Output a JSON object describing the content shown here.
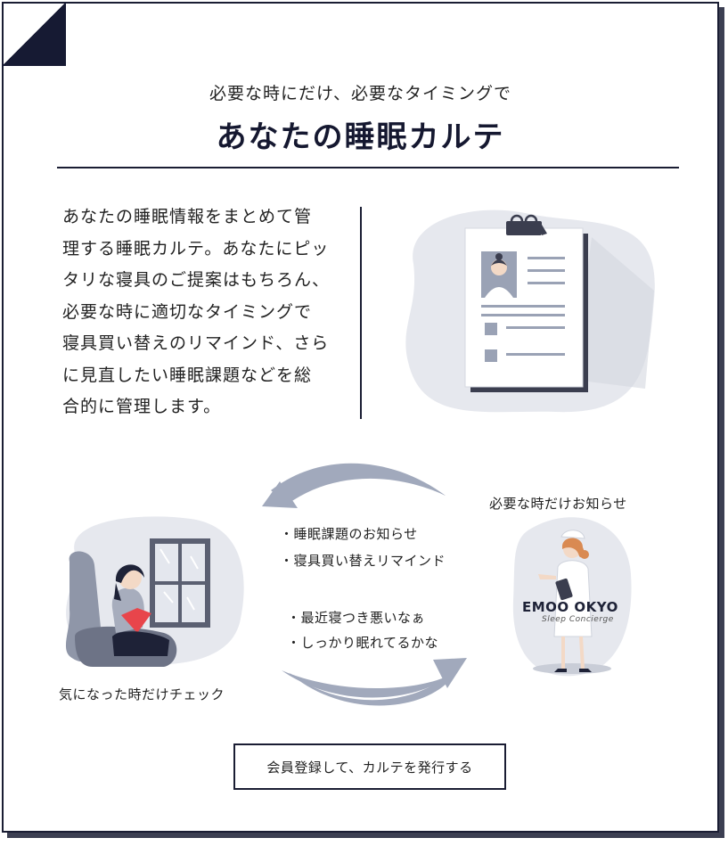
{
  "header": {
    "subtitle": "必要な時にだけ、必要なタイミングで",
    "title": "あなたの睡眠カルテ"
  },
  "description": {
    "lines": [
      "あなたの睡眠情報をまとめて管",
      "理する睡眠カルテ。あなたにピッ",
      "タリな寝具のご提案はもちろん、",
      "必要な時に適切なタイミングで",
      "寝具買い替えのリマインド、さら",
      "に見直したい睡眠課題などを総",
      "合的に管理します。"
    ]
  },
  "cycle": {
    "notify_items": [
      "・睡眠課題のお知らせ",
      "・寝具買い替えリマインド"
    ],
    "user_items": [
      "・最近寝つき悪いなぁ",
      "・しっかり眠れてるかな"
    ],
    "left_caption": "気になった時だけチェック",
    "right_caption": "必要な時だけお知らせ",
    "brand_text": "EMOO   OKYO",
    "brand_sub": "Sleep Concierge"
  },
  "cta": {
    "label": "会員登録して、カルテを発行する"
  },
  "colors": {
    "navy": "#1a1d33",
    "gray_blob": "#e6e8ee",
    "arrow": "#a1a9bc",
    "accent_red": "#e8454b"
  }
}
